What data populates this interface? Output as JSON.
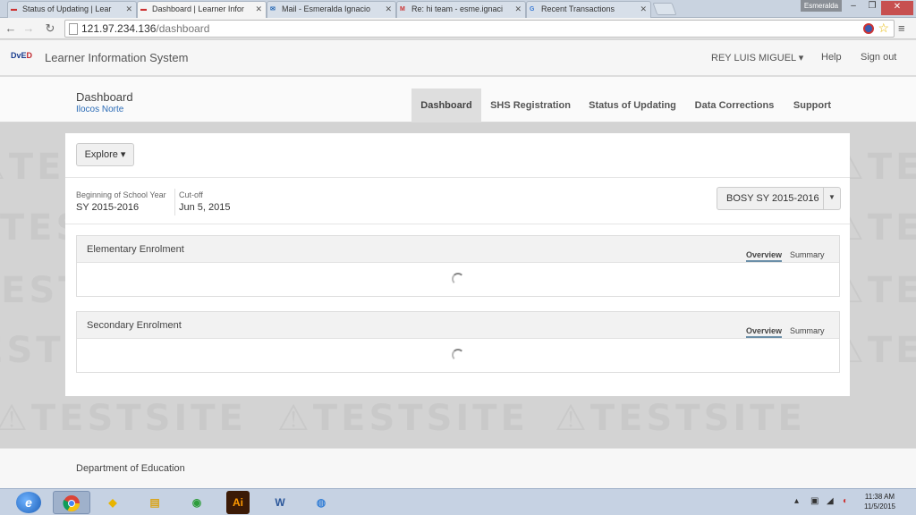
{
  "browser": {
    "tabs": [
      {
        "title": "Status of Updating | Lear",
        "icon": "deped-favicon"
      },
      {
        "title": "Dashboard | Learner Infor",
        "icon": "deped-favicon",
        "active": true
      },
      {
        "title": "Mail - Esmeralda Ignacio",
        "icon": "mail-favicon"
      },
      {
        "title": "Re: hi team - esme.ignaci",
        "icon": "gmail-favicon"
      },
      {
        "title": "Recent Transactions",
        "icon": "google-favicon"
      }
    ],
    "profile_name": "Esmeralda",
    "url_host": "121.97.234.136",
    "url_path": "/dashboard"
  },
  "app": {
    "logo_text_1": "DvE",
    "logo_text_2": "D",
    "title": "Learner Information System",
    "user_menu": "REY LUIS MIGUEL ▾",
    "help": "Help",
    "signout": "Sign out"
  },
  "subheader": {
    "page_title": "Dashboard",
    "region": "Ilocos Norte",
    "nav": [
      {
        "label": "Dashboard",
        "active": true
      },
      {
        "label": "SHS Registration"
      },
      {
        "label": "Status of Updating"
      },
      {
        "label": "Data Corrections"
      },
      {
        "label": "Support"
      }
    ]
  },
  "watermark": "⚠TESTSITE",
  "panel": {
    "explore_label": "Explore ▾",
    "sy_label": "Beginning of School Year",
    "sy_value": "SY 2015-2016",
    "cutoff_label": "Cut-off",
    "cutoff_value": "Jun 5, 2015",
    "bosy_select": "BOSY SY 2015-2016",
    "cards": [
      {
        "title": "Elementary Enrolment",
        "tab_overview": "Overview",
        "tab_summary": "Summary"
      },
      {
        "title": "Secondary Enrolment",
        "tab_overview": "Overview",
        "tab_summary": "Summary"
      }
    ]
  },
  "footer": {
    "text": "Department of Education"
  },
  "taskbar": {
    "apps": [
      "ie-icon",
      "chrome-icon",
      "paint-icon",
      "explorer-icon",
      "app-icon",
      "illustrator-icon",
      "word-icon",
      "settings-icon"
    ],
    "illustrator_label": "Ai",
    "word_label": "W",
    "clock_time": "11:38 AM",
    "clock_date": "11/5/2015"
  }
}
